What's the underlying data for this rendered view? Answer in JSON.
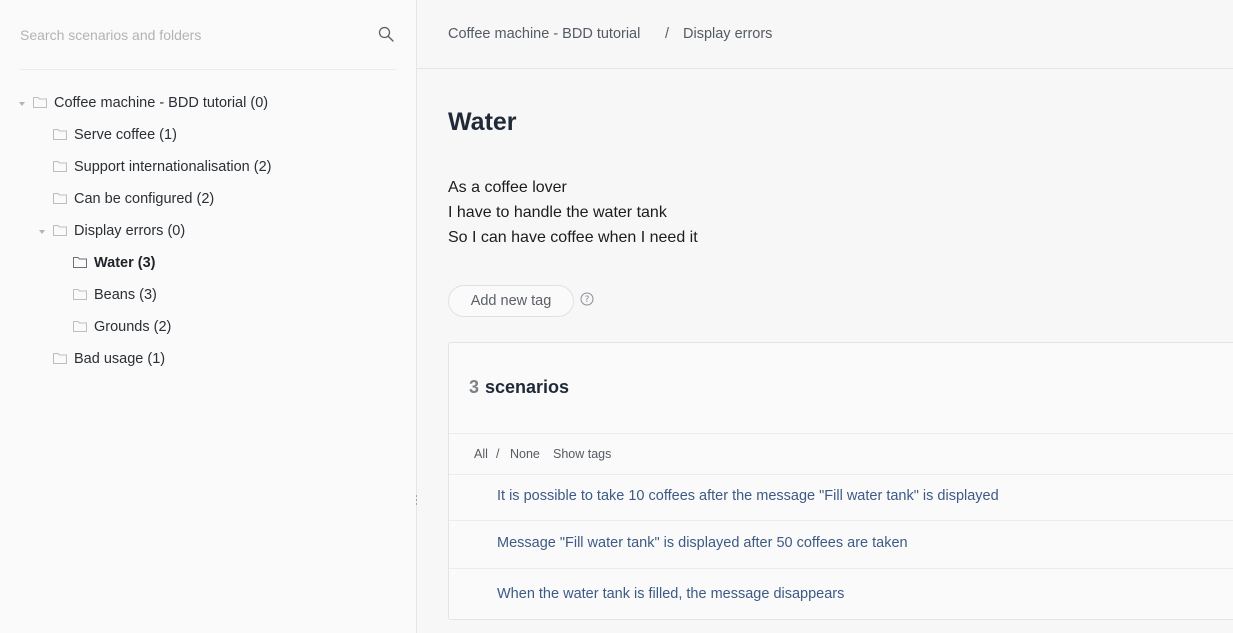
{
  "sidebar": {
    "search_placeholder": "Search scenarios and folders",
    "tree": [
      {
        "label": "Coffee machine - BDD tutorial (0)",
        "depth": 0,
        "expanded": true,
        "active": false
      },
      {
        "label": "Serve coffee (1)",
        "depth": 1,
        "expanded": false,
        "active": false
      },
      {
        "label": "Support internationalisation (2)",
        "depth": 1,
        "expanded": false,
        "active": false
      },
      {
        "label": "Can be configured (2)",
        "depth": 1,
        "expanded": false,
        "active": false
      },
      {
        "label": "Display errors (0)",
        "depth": 1,
        "expanded": true,
        "active": false
      },
      {
        "label": "Water (3)",
        "depth": 2,
        "expanded": false,
        "active": true
      },
      {
        "label": "Beans (3)",
        "depth": 2,
        "expanded": false,
        "active": false
      },
      {
        "label": "Grounds (2)",
        "depth": 2,
        "expanded": false,
        "active": false
      },
      {
        "label": "Bad usage (1)",
        "depth": 1,
        "expanded": false,
        "active": false
      }
    ]
  },
  "breadcrumb": {
    "parent": "Coffee machine - BDD tutorial",
    "separator": "/",
    "current": "Display errors"
  },
  "page": {
    "title": "Water",
    "description": [
      "As a coffee lover",
      "I have to handle the water tank",
      "So I can have coffee when I need it"
    ],
    "add_tag_label": "Add new tag"
  },
  "scenarios_panel": {
    "count": "3",
    "title": "scenarios",
    "filters": {
      "all": "All",
      "separator": "/",
      "none": "None",
      "show_tags": "Show tags"
    },
    "items": [
      "It is possible to take 10 coffees after the message \"Fill water tank\" is displayed",
      "Message \"Fill water tank\" is displayed after 50 coffees are taken",
      "When the water tank is filled, the message disappears"
    ]
  },
  "colors": {
    "link": "#3d5a86",
    "title": "#1f2a36",
    "border": "#e6e6e6"
  }
}
